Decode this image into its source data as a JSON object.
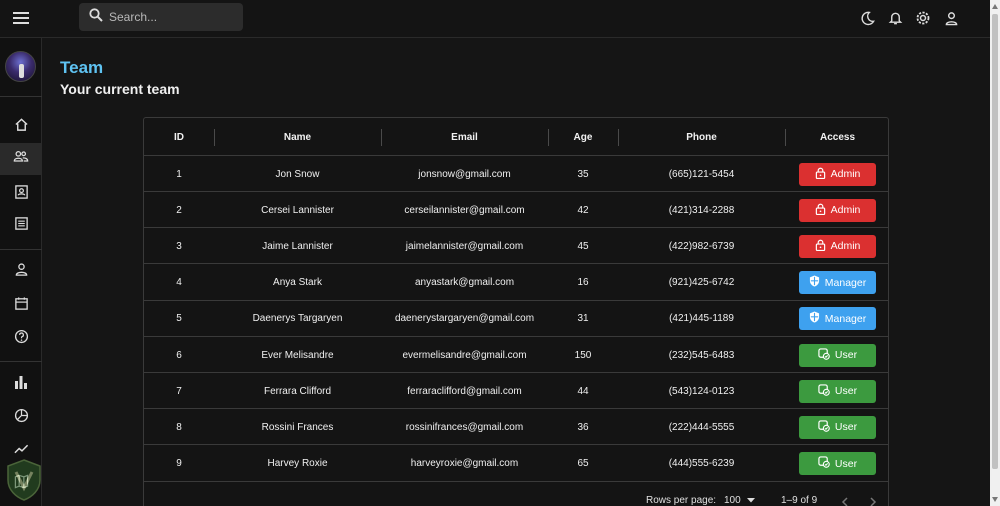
{
  "header": {
    "search_placeholder": "Search..."
  },
  "page": {
    "title": "Team",
    "subtitle": "Your current team"
  },
  "columns": {
    "id": "ID",
    "name": "Name",
    "email": "Email",
    "age": "Age",
    "phone": "Phone",
    "access": "Access"
  },
  "rows": [
    {
      "id": "1",
      "name": "Jon Snow",
      "email": "jonsnow@gmail.com",
      "age": "35",
      "phone": "(665)121-5454",
      "access": "Admin"
    },
    {
      "id": "2",
      "name": "Cersei Lannister",
      "email": "cerseilannister@gmail.com",
      "age": "42",
      "phone": "(421)314-2288",
      "access": "Admin"
    },
    {
      "id": "3",
      "name": "Jaime Lannister",
      "email": "jaimelannister@gmail.com",
      "age": "45",
      "phone": "(422)982-6739",
      "access": "Admin"
    },
    {
      "id": "4",
      "name": "Anya Stark",
      "email": "anyastark@gmail.com",
      "age": "16",
      "phone": "(921)425-6742",
      "access": "Manager"
    },
    {
      "id": "5",
      "name": "Daenerys Targaryen",
      "email": "daenerystargaryen@gmail.com",
      "age": "31",
      "phone": "(421)445-1189",
      "access": "Manager"
    },
    {
      "id": "6",
      "name": "Ever Melisandre",
      "email": "evermelisandre@gmail.com",
      "age": "150",
      "phone": "(232)545-6483",
      "access": "User"
    },
    {
      "id": "7",
      "name": "Ferrara Clifford",
      "email": "ferraraclifford@gmail.com",
      "age": "44",
      "phone": "(543)124-0123",
      "access": "User"
    },
    {
      "id": "8",
      "name": "Rossini Frances",
      "email": "rossinifrances@gmail.com",
      "age": "36",
      "phone": "(222)444-5555",
      "access": "User"
    },
    {
      "id": "9",
      "name": "Harvey Roxie",
      "email": "harveyroxie@gmail.com",
      "age": "65",
      "phone": "(444)555-6239",
      "access": "User"
    }
  ],
  "footer": {
    "rows_per_page_label": "Rows per page:",
    "rows_per_page_value": "100",
    "range_text": "1–9 of 9"
  },
  "colors": {
    "title": "#5fc3f2",
    "admin": "#db3030",
    "manager": "#3ea1ef",
    "user": "#3c9a3f"
  },
  "icons": {
    "topbar": [
      "menu-icon",
      "search-icon",
      "moon-icon",
      "bell-icon",
      "gear-icon",
      "person-icon"
    ],
    "sidebar": [
      "home-icon",
      "team-icon",
      "contacts-icon",
      "invoices-icon",
      "profile-icon",
      "calendar-icon",
      "help-icon",
      "bar-chart-icon",
      "pie-chart-icon",
      "line-chart-icon",
      "map-icon"
    ]
  }
}
